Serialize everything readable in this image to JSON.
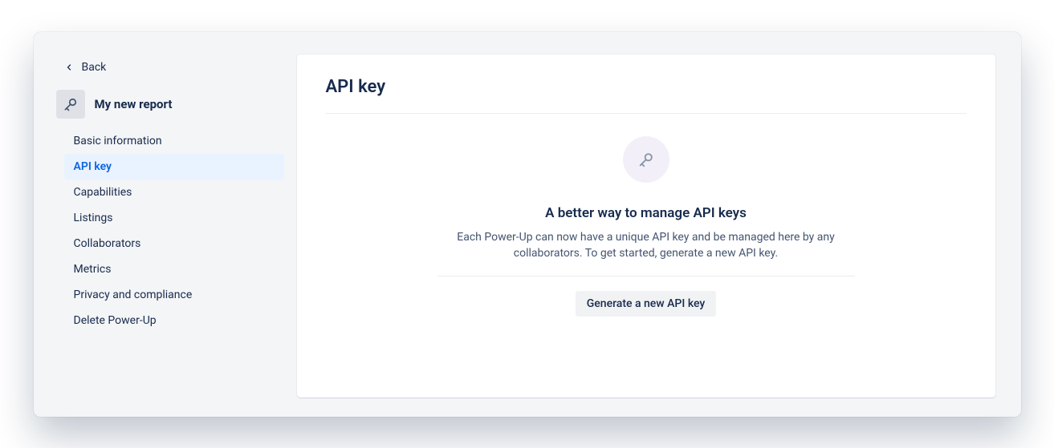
{
  "back": {
    "label": "Back"
  },
  "project": {
    "title": "My new report"
  },
  "sidebar": {
    "items": [
      {
        "label": "Basic information"
      },
      {
        "label": "API key"
      },
      {
        "label": "Capabilities"
      },
      {
        "label": "Listings"
      },
      {
        "label": "Collaborators"
      },
      {
        "label": "Metrics"
      },
      {
        "label": "Privacy and compliance"
      },
      {
        "label": "Delete Power-Up"
      }
    ],
    "activeIndex": 1
  },
  "main": {
    "title": "API key",
    "empty": {
      "heading": "A better way to manage API keys",
      "text": "Each Power-Up can now have a unique API key and be managed here by any collaborators. To get started, generate a new API key.",
      "button_label": "Generate a new API key"
    }
  }
}
